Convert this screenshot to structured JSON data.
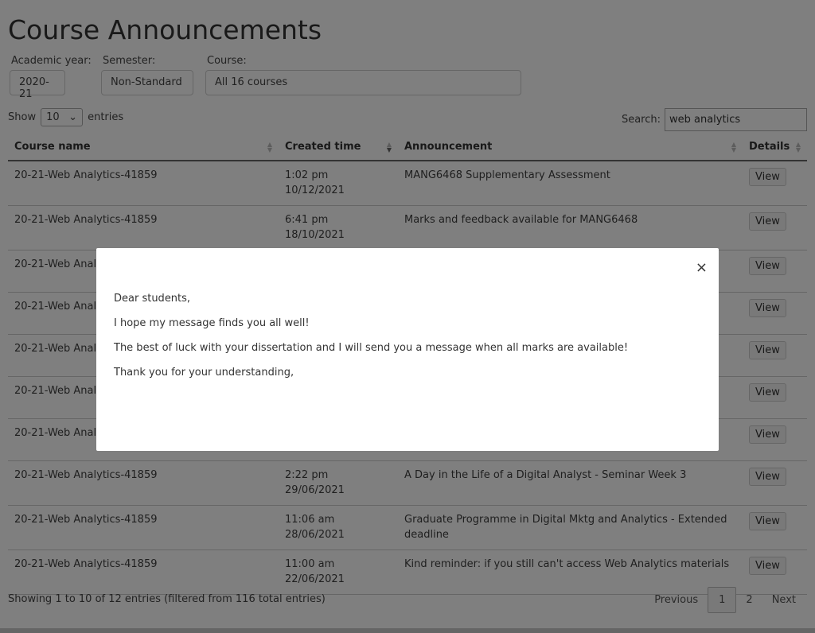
{
  "page_title": "Course Announcements",
  "filters": [
    {
      "label": "Academic year:",
      "value": "2020-21"
    },
    {
      "label": "Semester:",
      "value": "Non-Standard"
    },
    {
      "label": "Course:",
      "value": "All 16 courses"
    }
  ],
  "length": {
    "show": "Show",
    "value": "10",
    "entries": "entries"
  },
  "search": {
    "label": "Search:",
    "value": "web analytics"
  },
  "columns": [
    "Course name",
    "Created time",
    "Announcement",
    "Details"
  ],
  "rows": [
    {
      "course": "20-21-Web Analytics-41859",
      "time": "1:02 pm",
      "date": "10/12/2021",
      "announcement": "MANG6468 Supplementary Assessment",
      "details": "View"
    },
    {
      "course": "20-21-Web Analytics-41859",
      "time": "6:41 pm",
      "date": "18/10/2021",
      "announcement": "Marks and feedback available for MANG6468",
      "details": "View"
    },
    {
      "course": "20-21-Web Anal",
      "time": "",
      "date": "",
      "announcement": "",
      "details": "View"
    },
    {
      "course": "20-21-Web Anal",
      "time": "",
      "date": "",
      "announcement": "",
      "details": "View"
    },
    {
      "course": "20-21-Web Anal",
      "time": "",
      "date": "",
      "announcement": "",
      "details": "View"
    },
    {
      "course": "20-21-Web Anal",
      "time": "",
      "date": "",
      "announcement": "",
      "details": "View"
    },
    {
      "course": "20-21-Web Anal",
      "time": "",
      "date": "",
      "announcement": "",
      "details": "View"
    },
    {
      "course": "20-21-Web Analytics-41859",
      "time": "2:22 pm",
      "date": "29/06/2021",
      "announcement": "A Day in the Life of a Digital Analyst - Seminar Week 3",
      "details": "View"
    },
    {
      "course": "20-21-Web Analytics-41859",
      "time": "11:06 am",
      "date": "28/06/2021",
      "announcement": "Graduate Programme in Digital Mktg and Analytics - Extended deadline",
      "details": "View"
    },
    {
      "course": "20-21-Web Analytics-41859",
      "time": "11:00 am",
      "date": "22/06/2021",
      "announcement": "Kind reminder: if you still can't access Web Analytics materials",
      "details": "View"
    }
  ],
  "info": "Showing 1 to 10 of 12 entries (filtered from 116 total entries)",
  "pagination": {
    "previous": "Previous",
    "pages": [
      "1",
      "2"
    ],
    "next": "Next"
  },
  "modal": {
    "close": "×",
    "paragraphs": [
      "Dear students,",
      "I hope my message finds you all well!",
      "The best of luck with your dissertation and I will send you a message when all marks are available!",
      "Thank you for your understanding,"
    ]
  }
}
